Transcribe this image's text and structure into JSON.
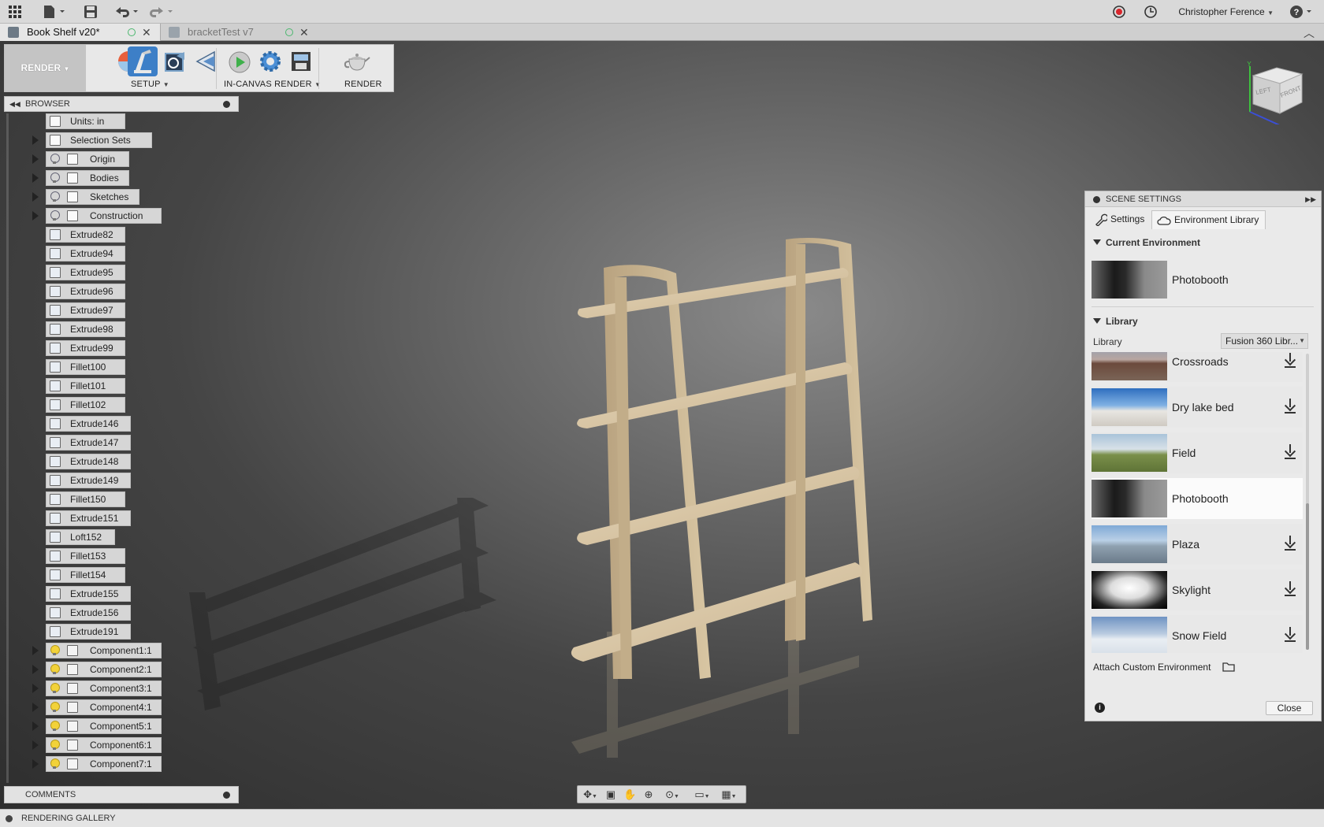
{
  "topbar": {
    "user_name": "Christopher Ference",
    "help_label": "?"
  },
  "tabs": [
    {
      "label": "Book Shelf v20*",
      "active": true
    },
    {
      "label": "bracketTest v7",
      "active": false
    }
  ],
  "toolbar": {
    "workspace_label": "RENDER",
    "groups": [
      {
        "label": "SETUP"
      },
      {
        "label": "IN-CANVAS RENDER"
      },
      {
        "label": "RENDER"
      }
    ]
  },
  "browser": {
    "title": "BROWSER",
    "items": [
      {
        "label": "Units: in",
        "type": "doc"
      },
      {
        "label": "Selection Sets",
        "type": "folder",
        "expandable": true
      },
      {
        "label": "Origin",
        "type": "folder",
        "expandable": true,
        "bulb": "off"
      },
      {
        "label": "Bodies",
        "type": "folder",
        "expandable": true,
        "bulb": "off"
      },
      {
        "label": "Sketches",
        "type": "folder",
        "expandable": true,
        "bulb": "off"
      },
      {
        "label": "Construction",
        "type": "folder",
        "expandable": true,
        "bulb": "off"
      },
      {
        "label": "Extrude82",
        "type": "extrude"
      },
      {
        "label": "Extrude94",
        "type": "extrude"
      },
      {
        "label": "Extrude95",
        "type": "extrude"
      },
      {
        "label": "Extrude96",
        "type": "extrude"
      },
      {
        "label": "Extrude97",
        "type": "extrude"
      },
      {
        "label": "Extrude98",
        "type": "extrude"
      },
      {
        "label": "Extrude99",
        "type": "extrude"
      },
      {
        "label": "Fillet100",
        "type": "fillet"
      },
      {
        "label": "Fillet101",
        "type": "fillet"
      },
      {
        "label": "Fillet102",
        "type": "fillet"
      },
      {
        "label": "Extrude146",
        "type": "extrude"
      },
      {
        "label": "Extrude147",
        "type": "extrude"
      },
      {
        "label": "Extrude148",
        "type": "extrude"
      },
      {
        "label": "Extrude149",
        "type": "extrude"
      },
      {
        "label": "Fillet150",
        "type": "fillet"
      },
      {
        "label": "Extrude151",
        "type": "extrude"
      },
      {
        "label": "Loft152",
        "type": "loft"
      },
      {
        "label": "Fillet153",
        "type": "fillet"
      },
      {
        "label": "Fillet154",
        "type": "fillet"
      },
      {
        "label": "Extrude155",
        "type": "extrude"
      },
      {
        "label": "Extrude156",
        "type": "extrude"
      },
      {
        "label": "Extrude191",
        "type": "extrude"
      },
      {
        "label": "Component1:1",
        "type": "component",
        "expandable": true,
        "bulb": "on"
      },
      {
        "label": "Component2:1",
        "type": "component",
        "expandable": true,
        "bulb": "on"
      },
      {
        "label": "Component3:1",
        "type": "component",
        "expandable": true,
        "bulb": "on"
      },
      {
        "label": "Component4:1",
        "type": "component",
        "expandable": true,
        "bulb": "on"
      },
      {
        "label": "Component5:1",
        "type": "component",
        "expandable": true,
        "bulb": "on"
      },
      {
        "label": "Component6:1",
        "type": "component",
        "expandable": true,
        "bulb": "on"
      },
      {
        "label": "Component7:1",
        "type": "component",
        "expandable": true,
        "bulb": "on"
      }
    ]
  },
  "comments": {
    "label": "COMMENTS"
  },
  "gallery": {
    "label": "RENDERING GALLERY"
  },
  "scene": {
    "title": "SCENE SETTINGS",
    "tabs": [
      {
        "label": "Settings",
        "active": false
      },
      {
        "label": "Environment Library",
        "active": true
      }
    ],
    "current_section": "Current Environment",
    "current_env": "Photobooth",
    "library_section": "Library",
    "library_field_label": "Library",
    "library_select_value": "Fusion 360 Libr...",
    "environments": [
      {
        "name": "Crossroads",
        "thumb": "crossroads",
        "download": true,
        "selected": false
      },
      {
        "name": "Dry lake bed",
        "thumb": "lake",
        "download": true,
        "selected": false
      },
      {
        "name": "Field",
        "thumb": "field",
        "download": true,
        "selected": false
      },
      {
        "name": "Photobooth",
        "thumb": "photobooth",
        "download": false,
        "selected": true
      },
      {
        "name": "Plaza",
        "thumb": "plaza",
        "download": true,
        "selected": false
      },
      {
        "name": "Skylight",
        "thumb": "skylight",
        "download": true,
        "selected": false
      },
      {
        "name": "Snow Field",
        "thumb": "snow",
        "download": true,
        "selected": false
      }
    ],
    "attach_label": "Attach Custom Environment",
    "close_label": "Close"
  },
  "viewcube": {
    "left": "LEFT",
    "front": "FRONT",
    "axis_y": "Y"
  }
}
